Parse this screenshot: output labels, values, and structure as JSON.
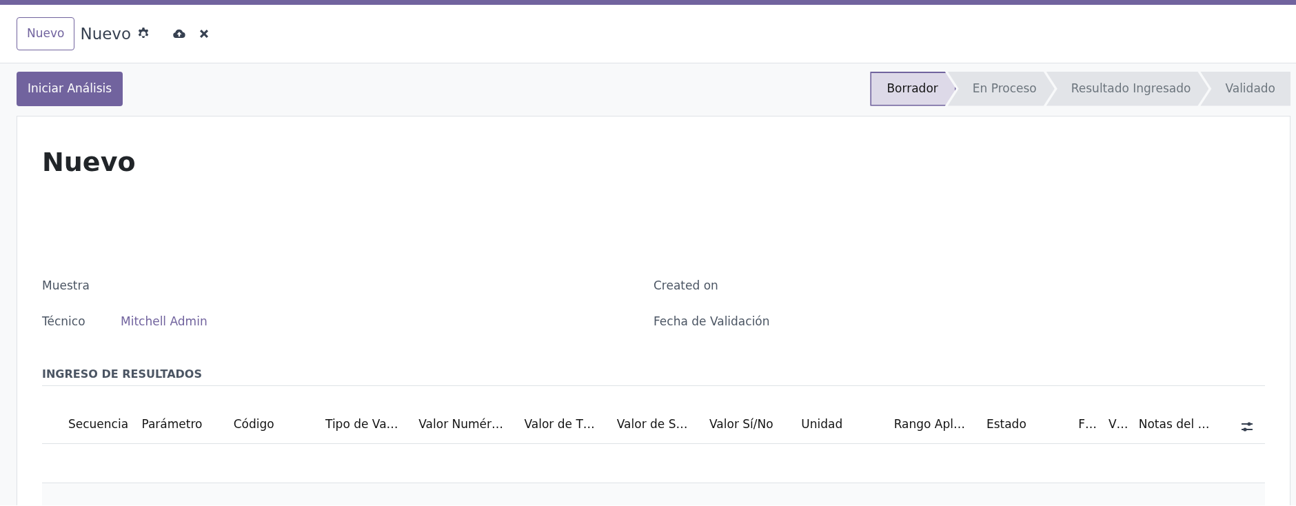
{
  "control_panel": {
    "new_button": "Nuevo",
    "breadcrumb": "Nuevo"
  },
  "actions": [
    {
      "label": "Iniciar Análisis"
    }
  ],
  "status_steps": [
    {
      "label": "Borrador",
      "selected": true
    },
    {
      "label": "En Proceso",
      "selected": false
    },
    {
      "label": "Resultado Ingresado",
      "selected": false
    },
    {
      "label": "Validado",
      "selected": false
    }
  ],
  "form": {
    "title": "Nuevo",
    "fields_left": [
      {
        "label": "Muestra"
      },
      {
        "label": "Técnico",
        "value": "Mitchell Admin"
      }
    ],
    "fields_right": [
      {
        "label": "Created on"
      },
      {
        "label": "Fecha de Validación"
      }
    ],
    "section": {
      "title": "INGRESO DE RESULTADOS",
      "columns": [
        "Secuencia",
        "Parámetro",
        "Código",
        "Tipo de Va…",
        "Valor Numér…",
        "Valor de T…",
        "Valor de S…",
        "Valor Sí/No",
        "Unidad",
        "Rango Apl…",
        "Estado",
        "F…",
        "V…",
        "Notas del …"
      ]
    }
  }
}
